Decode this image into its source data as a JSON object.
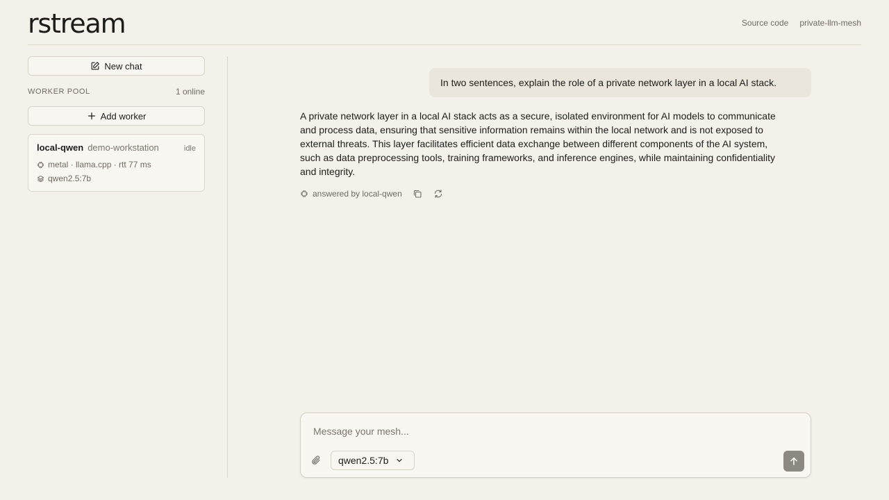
{
  "header": {
    "logo": "rstream",
    "links": [
      "Source code",
      "private-llm-mesh"
    ]
  },
  "sidebar": {
    "new_chat_label": "New chat",
    "pool_title": "WORKER POOL",
    "pool_count": "1 online",
    "add_worker_label": "Add worker",
    "worker": {
      "name": "local-qwen",
      "host": "demo-workstation",
      "status": "idle",
      "runtime": "metal · llama.cpp · rtt 77 ms",
      "model": "qwen2.5:7b"
    }
  },
  "chat": {
    "user_message": "In two sentences, explain the role of a private network layer in a local AI stack.",
    "assistant_message": "A private network layer in a local AI stack acts as a secure, isolated environment for AI models to communicate and process data, ensuring that sensitive information remains within the local network and is not exposed to external threats. This layer facilitates efficient data exchange between different components of the AI system, such as data preprocessing tools, training frameworks, and inference engines, while maintaining confidentiality and integrity.",
    "answered_by": "answered by local-qwen"
  },
  "composer": {
    "placeholder": "Message your mesh...",
    "value": "",
    "model": "qwen2.5:7b"
  },
  "icons": {
    "new_chat": "pencil-square-icon",
    "add_worker": "plus-icon",
    "runtime": "chip-icon",
    "model": "layers-icon",
    "copy": "copy-icon",
    "regenerate": "refresh-icon",
    "attach": "paperclip-icon",
    "dropdown": "chevron-down-icon",
    "send": "arrow-up-icon"
  },
  "colors": {
    "background": "#f4f1ea",
    "user_bubble": "#ebe6dc",
    "send_button": "#8c8983"
  }
}
